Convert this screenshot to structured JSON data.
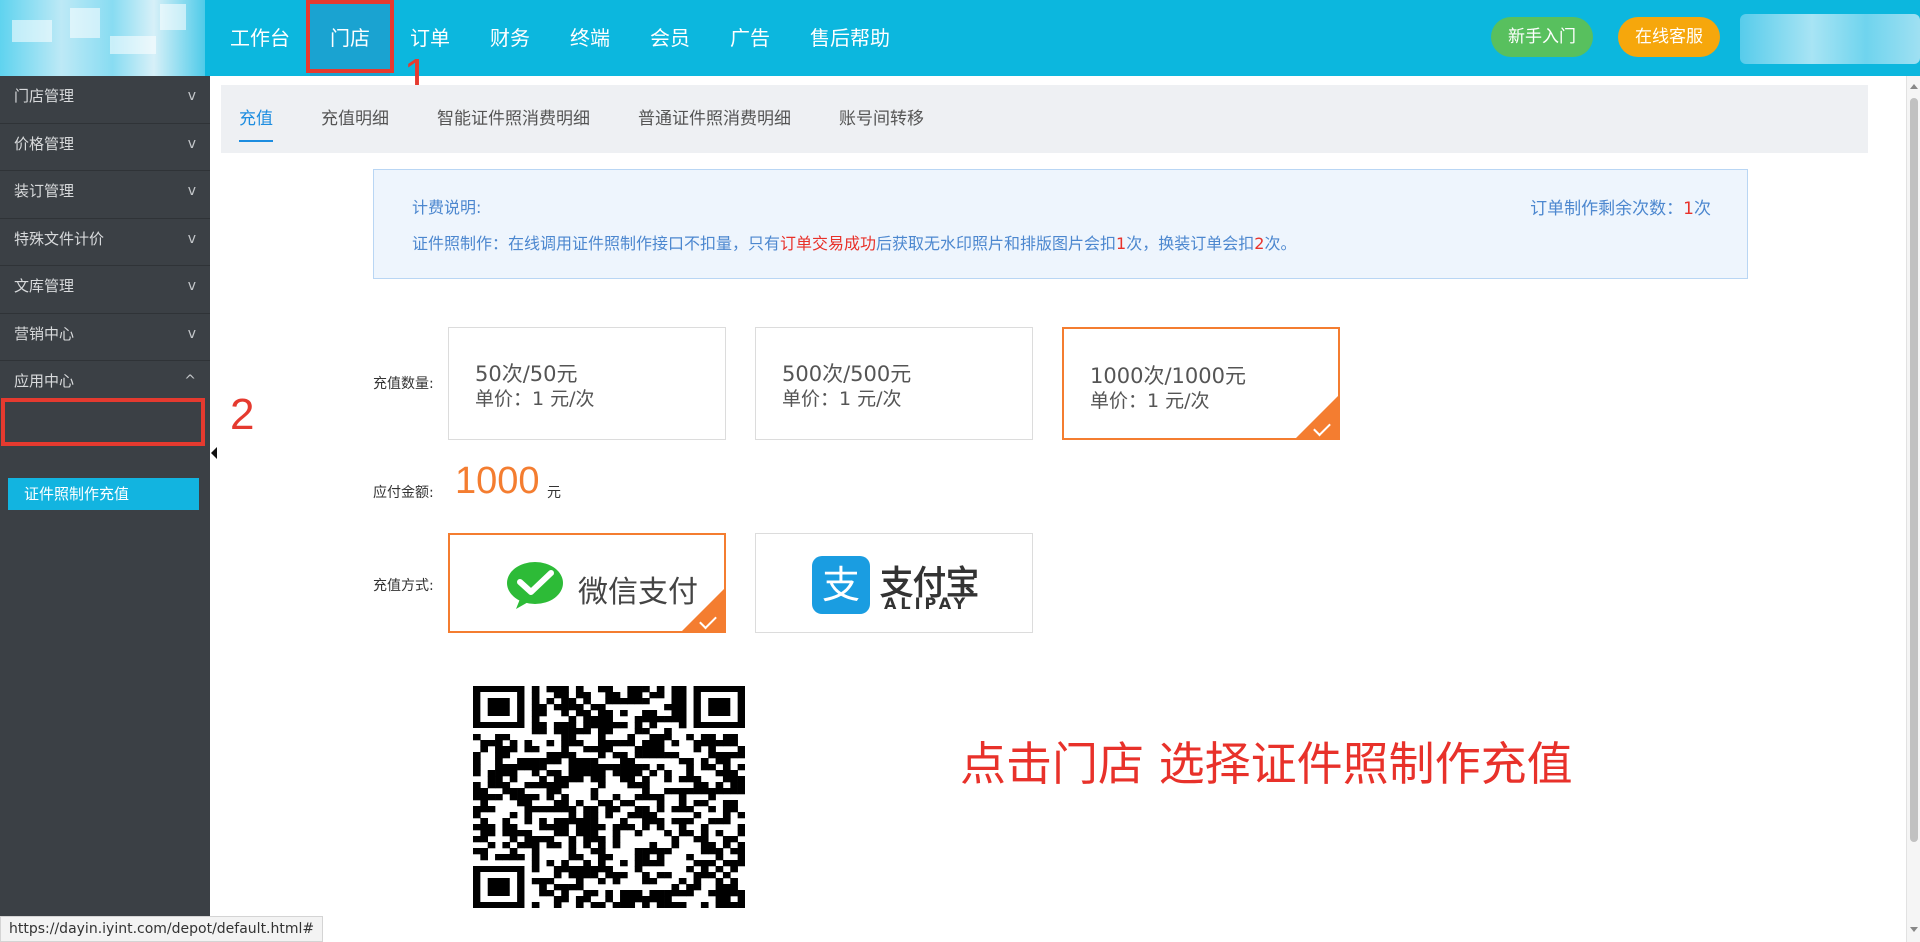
{
  "header": {
    "nav": [
      "工作台",
      "门店",
      "订单",
      "财务",
      "终端",
      "会员",
      "广告",
      "售后帮助"
    ],
    "active_nav": "门店",
    "beginner_btn": "新手入门",
    "service_btn": "在线客服"
  },
  "sidebar": {
    "items": [
      {
        "label": "门店管理",
        "chev": "v"
      },
      {
        "label": "价格管理",
        "chev": "v"
      },
      {
        "label": "装订管理",
        "chev": "v"
      },
      {
        "label": "特殊文件计价",
        "chev": "v"
      },
      {
        "label": "文库管理",
        "chev": "v"
      },
      {
        "label": "营销中心",
        "chev": "v"
      },
      {
        "label": "应用中心",
        "chev": "^"
      }
    ],
    "active_sub": "证件照制作充值"
  },
  "annotations": {
    "num1": "1",
    "num2": "2"
  },
  "tabs": [
    "充值",
    "充值明细",
    "智能证件照消费明细",
    "普通证件照消费明细",
    "账号间转移"
  ],
  "info": {
    "title": "计费说明:",
    "line_pre": "证件照制作：在线调用证件照制作接口不扣量，只有",
    "line_red1": "订单交易成功",
    "line_mid1": "后获取无水印照片和排版图片会扣",
    "line_red2": "1",
    "line_mid2": "次，换装订单会扣",
    "line_red3": "2",
    "line_post": "次。",
    "remain_label": "订单制作剩余次数：",
    "remain_value": "1",
    "remain_unit": "次"
  },
  "recharge": {
    "qty_label": "充值数量:",
    "options": [
      {
        "q": "50次/50元",
        "p": "单价：1 元/次",
        "selected": false
      },
      {
        "q": "500次/500元",
        "p": "单价：1 元/次",
        "selected": false
      },
      {
        "q": "1000次/1000元",
        "p": "单价：1 元/次",
        "selected": true
      }
    ],
    "amount_label": "应付金额:",
    "amount": "1000",
    "amount_unit": "元",
    "method_label": "充值方式:",
    "wechat_text": "微信支付",
    "alipay_cn": "支付宝",
    "alipay_en": "ALIPAY",
    "alipay_icon_char": "支"
  },
  "qr_note": "点击门店 选择证件照制作充值",
  "status_url": "https://dayin.iyint.com/depot/default.html#",
  "colors": {
    "brand": "#0cb7de",
    "accent": "#f47d30",
    "annotation": "#e53a2f",
    "sidebar": "#3b4045"
  }
}
